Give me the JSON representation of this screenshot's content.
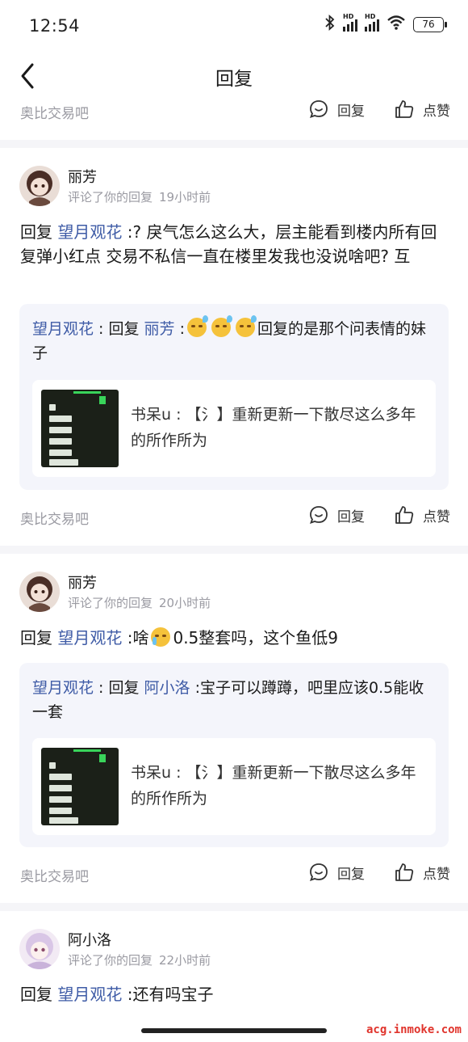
{
  "status": {
    "time": "12:54",
    "battery": "76",
    "signal1": "HD",
    "signal2": "HD"
  },
  "nav": {
    "title": "回复"
  },
  "top_footer": {
    "forum": "奥比交易吧",
    "reply": "回复",
    "like": "点赞"
  },
  "items": [
    {
      "user": "丽芳",
      "action": "评论了你的回复",
      "time": "19小时前",
      "body_prefix": "回复 ",
      "body_link": "望月观花",
      "body_text": " :? 戾气怎么这么大，层主能看到楼内所有回复弹小红点 交易不私信一直在楼里发我也没说啥吧? 互",
      "quote": {
        "author": "望月观花",
        "sep": " : 回复 ",
        "target": "丽芳",
        "text_before": " :",
        "emoji": [
          "sweat-emoji",
          "sweat-emoji",
          "sweat-emoji"
        ],
        "text_after": "回复的是那个问表情的妹子"
      },
      "orig": {
        "text": "书呆u : 【氵】重新更新一下散尽这么多年的所作所为"
      },
      "footer": {
        "forum": "奥比交易吧",
        "reply": "回复",
        "like": "点赞"
      }
    },
    {
      "user": "丽芳",
      "action": "评论了你的回复",
      "time": "20小时前",
      "body_prefix": "回复 ",
      "body_link": "望月观花",
      "body_text_a": " :啥",
      "body_emoji": "crying-emoji",
      "body_text_b": "0.5整套吗，这个鱼低9",
      "quote": {
        "author": "望月观花",
        "sep": " : 回复 ",
        "target": "阿小洛",
        "text": " :宝子可以蹲蹲，吧里应该0.5能收一套"
      },
      "orig": {
        "text": "书呆u : 【氵】重新更新一下散尽这么多年的所作所为"
      },
      "footer": {
        "forum": "奥比交易吧",
        "reply": "回复",
        "like": "点赞"
      }
    },
    {
      "user": "阿小洛",
      "action": "评论了你的回复",
      "time": "22小时前",
      "body_prefix": "回复 ",
      "body_link": "望月观花",
      "body_text": " :还有吗宝子"
    }
  ],
  "watermark": "acg.inmoke.com",
  "colors": {
    "link": "#3e5ba6",
    "muted": "#9a9aa2",
    "card": "#f4f5fb",
    "divider": "#f5f5f8"
  }
}
